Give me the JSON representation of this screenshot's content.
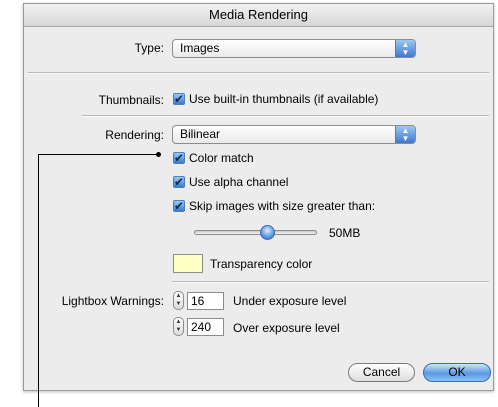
{
  "window": {
    "title": "Media Rendering"
  },
  "type_row": {
    "label": "Type:",
    "value": "Images"
  },
  "thumbnails": {
    "label": "Thumbnails:",
    "checkbox_label": "Use built-in thumbnails (if available)",
    "checked": true
  },
  "rendering_row": {
    "label": "Rendering:",
    "value": "Bilinear"
  },
  "options": [
    {
      "label": "Color match",
      "checked": true
    },
    {
      "label": "Use alpha channel",
      "checked": true
    },
    {
      "label": "Skip images with size greater than:",
      "checked": true
    }
  ],
  "size_slider": {
    "value_text": "50MB"
  },
  "transparency": {
    "label": "Transparency color",
    "color": "#ffffc6"
  },
  "lightbox": {
    "label": "Lightbox Warnings:",
    "under": {
      "value": "16",
      "label": "Under exposure level"
    },
    "over": {
      "value": "240",
      "label": "Over exposure level"
    }
  },
  "buttons": {
    "cancel": "Cancel",
    "ok": "OK"
  },
  "icons": {
    "check": "✔",
    "popup_arrows": "updown-arrows"
  }
}
